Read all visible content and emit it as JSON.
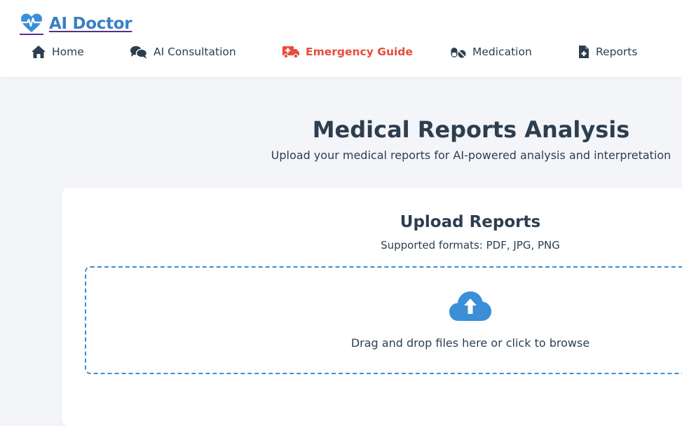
{
  "brand": {
    "name": "AI Doctor",
    "icon": "heartbeat-icon",
    "accent_color": "#3a7fc4"
  },
  "nav": {
    "items": [
      {
        "label": "Home",
        "icon": "home-icon"
      },
      {
        "label": "AI Consultation",
        "icon": "comments-icon"
      },
      {
        "label": "Emergency Guide",
        "icon": "ambulance-icon",
        "active": true
      },
      {
        "label": "Medication",
        "icon": "pills-icon"
      },
      {
        "label": "Reports",
        "icon": "file-medical-icon"
      }
    ],
    "active_color": "#e74c3c"
  },
  "main": {
    "title": "Medical Reports Analysis",
    "subtitle": "Upload your medical reports for AI-powered analysis and interpretation"
  },
  "upload": {
    "title": "Upload Reports",
    "formats_text": "Supported formats: PDF, JPG, PNG",
    "dropzone_text": "Drag and drop files here or click to browse",
    "icon": "cloud-upload-icon",
    "border_color": "#3a8fd6"
  }
}
